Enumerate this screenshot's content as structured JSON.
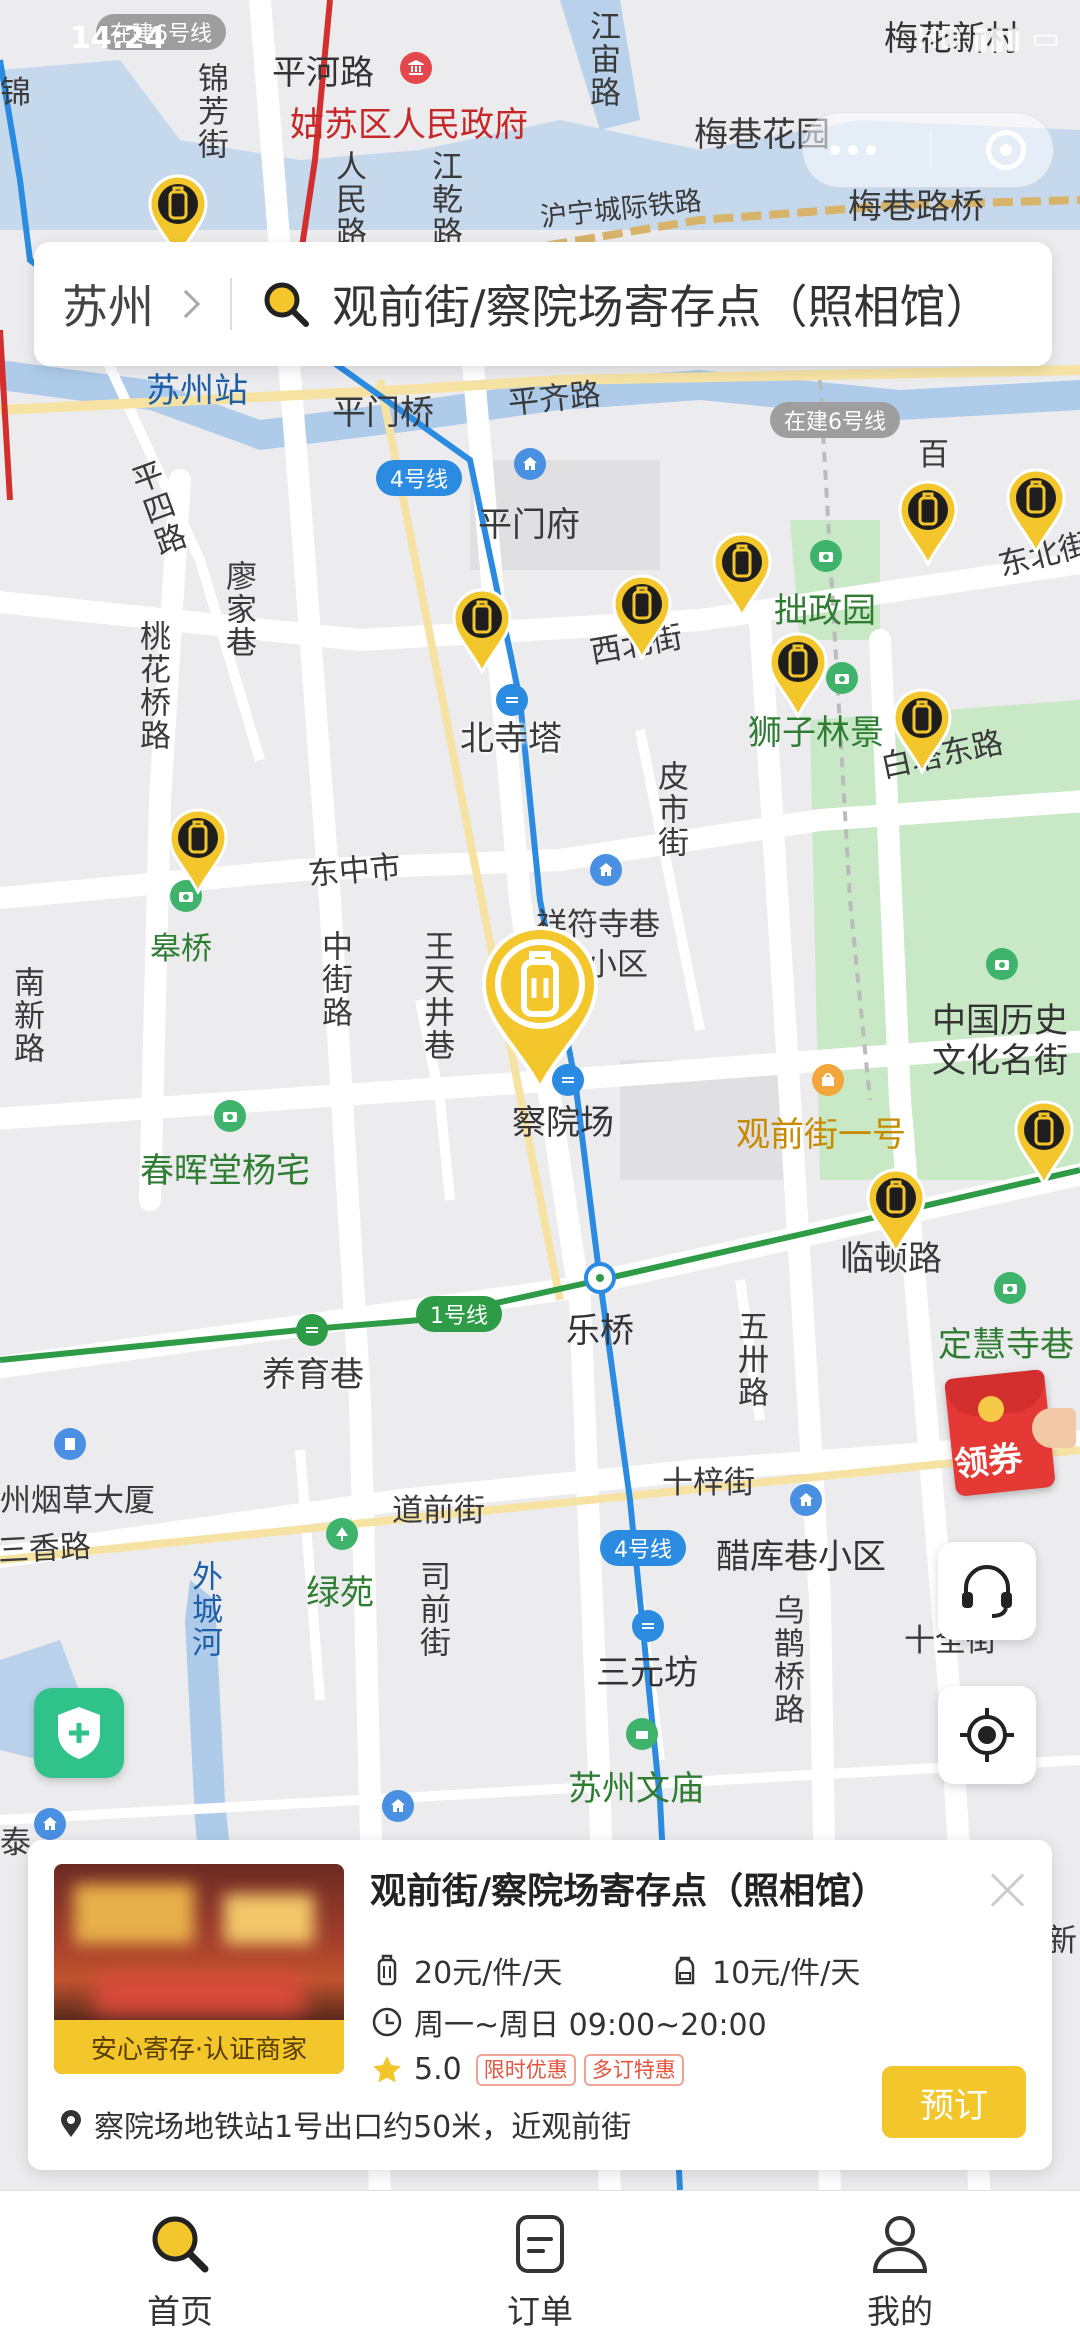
{
  "status_bar": {
    "time": "14:24",
    "right_text": "HD"
  },
  "search": {
    "city": "苏州",
    "query": "观前街/察院场寄存点（照相馆）"
  },
  "map": {
    "streets": [
      "平河路",
      "锦芳街",
      "人民路",
      "江乾路",
      "江宙路",
      "梅巷花园",
      "梅巷路桥",
      "沪宁城际铁路",
      "平门桥",
      "平齐路",
      "平门府",
      "平四路",
      "廖家巷",
      "桃花桥路",
      "西北街",
      "北寺塔",
      "皮市街",
      "白塔东路",
      "东北街",
      "东中市",
      "中街路",
      "王天井巷",
      "南新路",
      "养育巷",
      "五卅路",
      "十梓街",
      "道前街",
      "三香路",
      "外城河",
      "司前街",
      "乌鹊桥路",
      "十全街",
      "临顿路",
      "百",
      "锦",
      "泰"
    ],
    "places": [
      "姑苏区人民政府",
      "梅花新村",
      "苏州站",
      "拙政园",
      "狮子林景",
      "皋桥",
      "祥符寺巷",
      "小区",
      "察院场",
      "中国历史",
      "文化名街",
      "观前街一号",
      "春晖堂杨宅",
      "乐桥",
      "定慧寺巷",
      "州烟草大厦",
      "醋库巷小区",
      "绿苑",
      "三元坊",
      "苏州文庙",
      "新"
    ],
    "line_tags": [
      "在建6号线",
      "4号线",
      "在建6号线",
      "1号线",
      "4号线"
    ]
  },
  "coupon_label": "领券",
  "card": {
    "title": "观前街/察院场寄存点（照相馆）",
    "badge": "安心寄存·认证商家",
    "price_large": "20元/件/天",
    "price_small": "10元/件/天",
    "hours": "周一~周日 09:00~20:00",
    "rating": "5.0",
    "tags": [
      "限时优惠",
      "多订特惠"
    ],
    "address": "察院场地铁站1号出口约50米，近观前街",
    "book_label": "预订"
  },
  "tabs": [
    {
      "label": "首页",
      "icon": "search-icon"
    },
    {
      "label": "订单",
      "icon": "order-icon"
    },
    {
      "label": "我的",
      "icon": "user-icon"
    }
  ],
  "colors": {
    "accent": "#f3c72c",
    "metro_blue": "#2b8be0",
    "metro_green": "#2e9b47",
    "park_green": "#c9e8c6"
  }
}
